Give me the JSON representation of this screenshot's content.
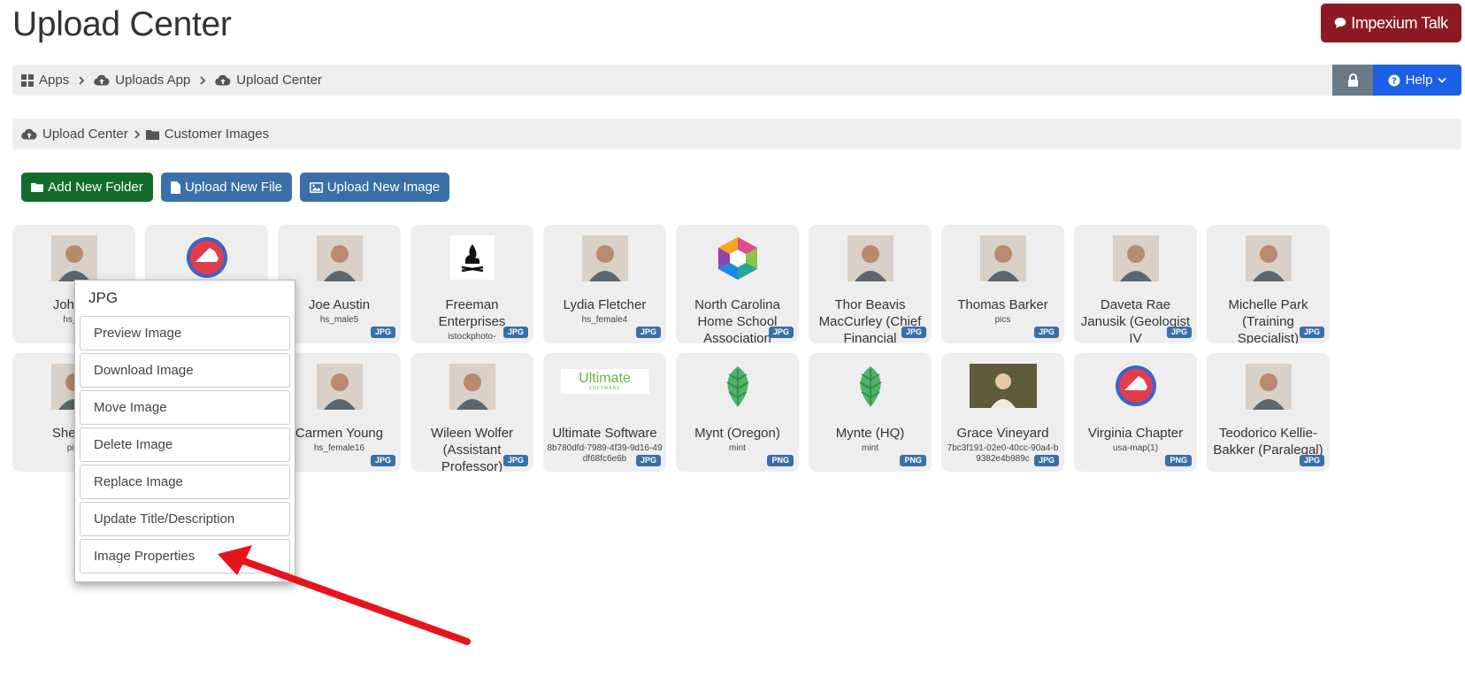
{
  "header": {
    "title": "Upload Center",
    "talk_button": "Impexium Talk"
  },
  "breadcrumb": {
    "items": [
      "Apps",
      "Uploads App",
      "Upload Center"
    ],
    "help_label": "Help"
  },
  "folder_path": {
    "items": [
      "Upload Center",
      "Customer Images"
    ]
  },
  "actions": {
    "add_folder": "Add New Folder",
    "upload_file": "Upload New File",
    "upload_image": "Upload New Image"
  },
  "tiles": [
    {
      "title": "John R",
      "sub": "hs_m",
      "badge": "",
      "thumb": "person"
    },
    {
      "title": "",
      "sub": "",
      "badge": "",
      "thumb": "va-logo"
    },
    {
      "title": "Joe Austin",
      "sub": "hs_male5",
      "badge": "JPG",
      "thumb": "person"
    },
    {
      "title": "Freeman Enterprises",
      "sub": "istockphoto-",
      "badge": "JPG",
      "thumb": "fire-logo"
    },
    {
      "title": "Lydia Fletcher",
      "sub": "hs_female4",
      "badge": "JPG",
      "thumb": "person"
    },
    {
      "title": "North Carolina Home School Association",
      "sub": "",
      "badge": "JPG",
      "thumb": "hex-logo"
    },
    {
      "title": "Thor Beavis MacCurley (Chief Financial",
      "sub": "",
      "badge": "JPG",
      "thumb": "person"
    },
    {
      "title": "Thomas Barker",
      "sub": "pics",
      "badge": "JPG",
      "thumb": "person"
    },
    {
      "title": "Daveta Rae Janusik (Geologist IV",
      "sub": "",
      "badge": "JPG",
      "thumb": "person"
    },
    {
      "title": "Michelle Park (Training Specialist)",
      "sub": "",
      "badge": "JPG",
      "thumb": "person"
    },
    {
      "title": "Shelley",
      "sub": "pict",
      "badge": "",
      "thumb": "person"
    },
    {
      "title": "",
      "sub": "",
      "badge": "",
      "thumb": "blank"
    },
    {
      "title": "Carmen Young",
      "sub": "hs_female16",
      "badge": "JPG",
      "thumb": "person"
    },
    {
      "title": "Wileen Wolfer (Assistant Professor)",
      "sub": "",
      "badge": "JPG",
      "thumb": "person"
    },
    {
      "title": "Ultimate Software",
      "sub": "8b780dfd-7989-4f39-9d16-49df68fc6e6b",
      "badge": "JPG",
      "thumb": "ultimate-logo"
    },
    {
      "title": "Mynt (Oregon)",
      "sub": "mint",
      "badge": "PNG",
      "thumb": "leaf"
    },
    {
      "title": "Mynte (HQ)",
      "sub": "mint",
      "badge": "PNG",
      "thumb": "leaf"
    },
    {
      "title": "Grace Vineyard",
      "sub": "7bc3f191-02e0-40cc-90a4-b9382e4b989c",
      "badge": "JPG",
      "thumb": "person-wide"
    },
    {
      "title": "Virginia Chapter",
      "sub": "usa-map(1)",
      "badge": "PNG",
      "thumb": "va-logo"
    },
    {
      "title": "Teodorico Kellie-Bakker (Paralegal)",
      "sub": "",
      "badge": "JPG",
      "thumb": "person"
    }
  ],
  "context_menu": {
    "title": "JPG",
    "items": [
      "Preview Image",
      "Download Image",
      "Move Image",
      "Delete Image",
      "Replace Image",
      "Update Title/Description",
      "Image Properties"
    ]
  },
  "colors": {
    "talk": "#8c1a24",
    "help": "#1a5fe6",
    "green": "#146c2b",
    "blue": "#3a6fa8",
    "arrow": "#e8141b"
  },
  "ultimate_logo": {
    "word": "Ultimate",
    "sub": "SOFTWARE"
  }
}
